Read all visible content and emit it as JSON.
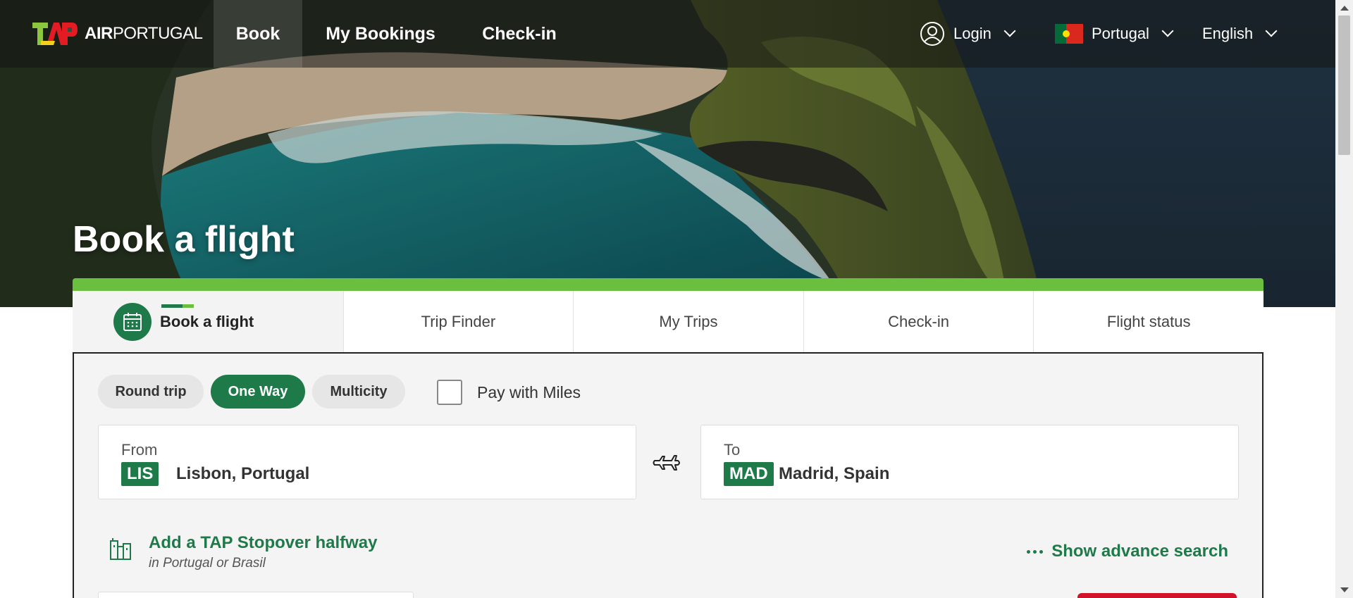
{
  "topnav": {
    "logo_brand": "TAP",
    "logo_text_bold": "AIR",
    "logo_text": "PORTUGAL",
    "items": [
      {
        "label": "Book"
      },
      {
        "label": "My Bookings"
      },
      {
        "label": "Check-in"
      }
    ],
    "login_label": "Login",
    "country_label": "Portugal",
    "language_label": "English"
  },
  "hero": {
    "title": "Book a flight"
  },
  "widget": {
    "tabs": [
      {
        "label": "Book a flight"
      },
      {
        "label": "Trip Finder"
      },
      {
        "label": "My Trips"
      },
      {
        "label": "Check-in"
      },
      {
        "label": "Flight status"
      }
    ],
    "trip_types": {
      "round": "Round trip",
      "oneway": "One Way",
      "multi": "Multicity"
    },
    "pay_with_miles": "Pay with Miles",
    "from": {
      "label": "From",
      "code": "LIS",
      "city": "Lisbon, Portugal"
    },
    "to": {
      "label": "To",
      "code": "MAD",
      "city": "Madrid, Spain"
    },
    "stopover_title": "Add a TAP Stopover halfway",
    "stopover_sub": "in Portugal or Brasil",
    "advanced_search": "Show advance search"
  },
  "colors": {
    "brand_green": "#1f7a4a",
    "accent_green": "#6abf3f",
    "brand_red": "#d0132b"
  }
}
